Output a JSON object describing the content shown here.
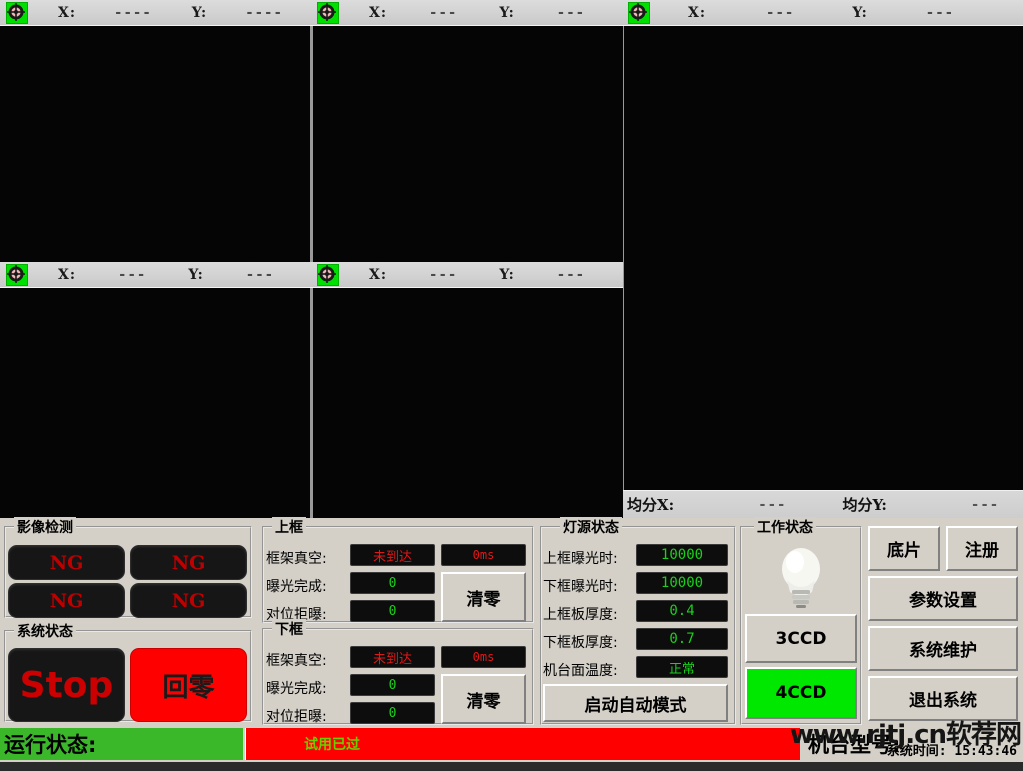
{
  "coord_bars": {
    "top": [
      {
        "icon": "crosshair-target-icon",
        "x_label": "X:",
        "x_value": "----",
        "y_label": "Y:",
        "y_value": "----"
      },
      {
        "icon": "crosshair-target-icon",
        "x_label": "X:",
        "x_value": "---",
        "y_label": "Y:",
        "y_value": "---"
      },
      {
        "icon": "crosshair-target-icon",
        "x_label": "X:",
        "x_value": "---",
        "y_label": "Y:",
        "y_value": "---"
      }
    ],
    "middle": [
      {
        "icon": "crosshair-target-icon",
        "x_label": "X:",
        "x_value": "---",
        "y_label": "Y:",
        "y_value": "---"
      },
      {
        "icon": "crosshair-target-icon",
        "x_label": "X:",
        "x_value": "---",
        "y_label": "Y:",
        "y_value": "---"
      }
    ]
  },
  "average": {
    "x_label": "均分X:",
    "x_value": "---",
    "y_label": "均分Y:",
    "y_value": "---"
  },
  "image_detection": {
    "title": "影像检测",
    "cells": [
      "NG",
      "NG",
      "NG",
      "NG"
    ]
  },
  "system_status": {
    "title": "系统状态",
    "stop_label": "Stop",
    "home_label": "回零"
  },
  "upper_frame": {
    "title": "上框",
    "rows": [
      {
        "label": "框架真空:",
        "value": "未到达",
        "color": "red"
      },
      {
        "label": "曝光完成:",
        "value": "0",
        "color": "green"
      },
      {
        "label": "对位拒曝:",
        "value": "0",
        "color": "green"
      }
    ],
    "ms_value": "0ms",
    "clear_label": "清零"
  },
  "lower_frame": {
    "title": "下框",
    "rows": [
      {
        "label": "框架真空:",
        "value": "未到达",
        "color": "red"
      },
      {
        "label": "曝光完成:",
        "value": "0",
        "color": "green"
      },
      {
        "label": "对位拒曝:",
        "value": "0",
        "color": "green"
      }
    ],
    "ms_value": "0ms",
    "clear_label": "清零"
  },
  "light_source": {
    "title": "灯源状态",
    "rows": [
      {
        "label": "上框曝光时:",
        "value": "10000"
      },
      {
        "label": "下框曝光时:",
        "value": "10000"
      },
      {
        "label": "上框板厚度:",
        "value": "0.4"
      },
      {
        "label": "下框板厚度:",
        "value": "0.7"
      },
      {
        "label": "机台面温度:",
        "value": "正常"
      }
    ],
    "auto_mode_label": "启动自动模式"
  },
  "work_status": {
    "title": "工作状态",
    "bulb_icon": "lightbulb-icon",
    "ccd3_label": "3CCD",
    "ccd4_label": "4CCD",
    "active": "4CCD",
    "active_color": "#00e800"
  },
  "right_buttons": {
    "film_label": "底片",
    "register_label": "注册",
    "params_label": "参数设置",
    "maintenance_label": "系统维护",
    "exit_label": "退出系统"
  },
  "status_bar": {
    "run_status_label": "运行状态:",
    "trial_text": "试用已过",
    "machine_model_label": "机台型号:",
    "system_time_label": "系统时间:",
    "system_time_value": "15:43:46",
    "green_color": "#3ab82a",
    "red_color": "#fe0000"
  },
  "watermark": {
    "text": "www.rjtj.cn软荐网"
  }
}
